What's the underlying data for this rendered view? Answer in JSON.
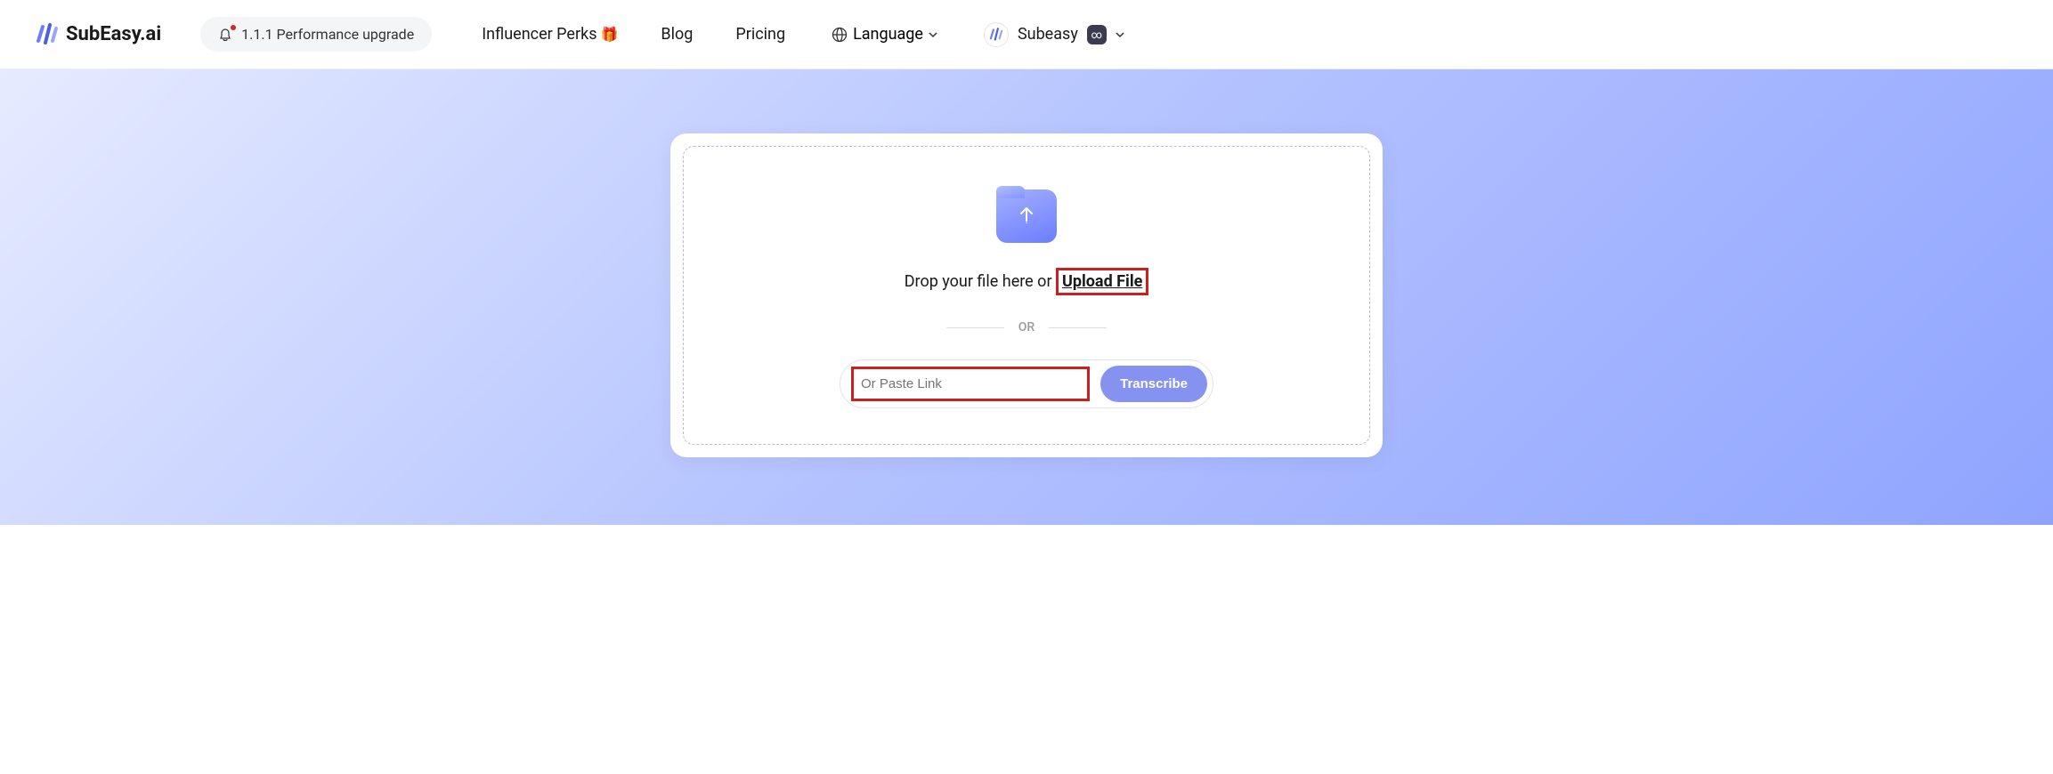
{
  "header": {
    "brand": "SubEasy.ai",
    "upgrade_label": "1.1.1 Performance upgrade"
  },
  "nav": {
    "influencer": "Influencer Perks",
    "blog": "Blog",
    "pricing": "Pricing",
    "language_label": "Language"
  },
  "user": {
    "name": "Subeasy",
    "badge": "∞"
  },
  "upload": {
    "drop_prefix": "Drop your file here or ",
    "upload_link": "Upload File",
    "or": "OR",
    "paste_placeholder": "Or Paste Link",
    "transcribe_label": "Transcribe"
  }
}
